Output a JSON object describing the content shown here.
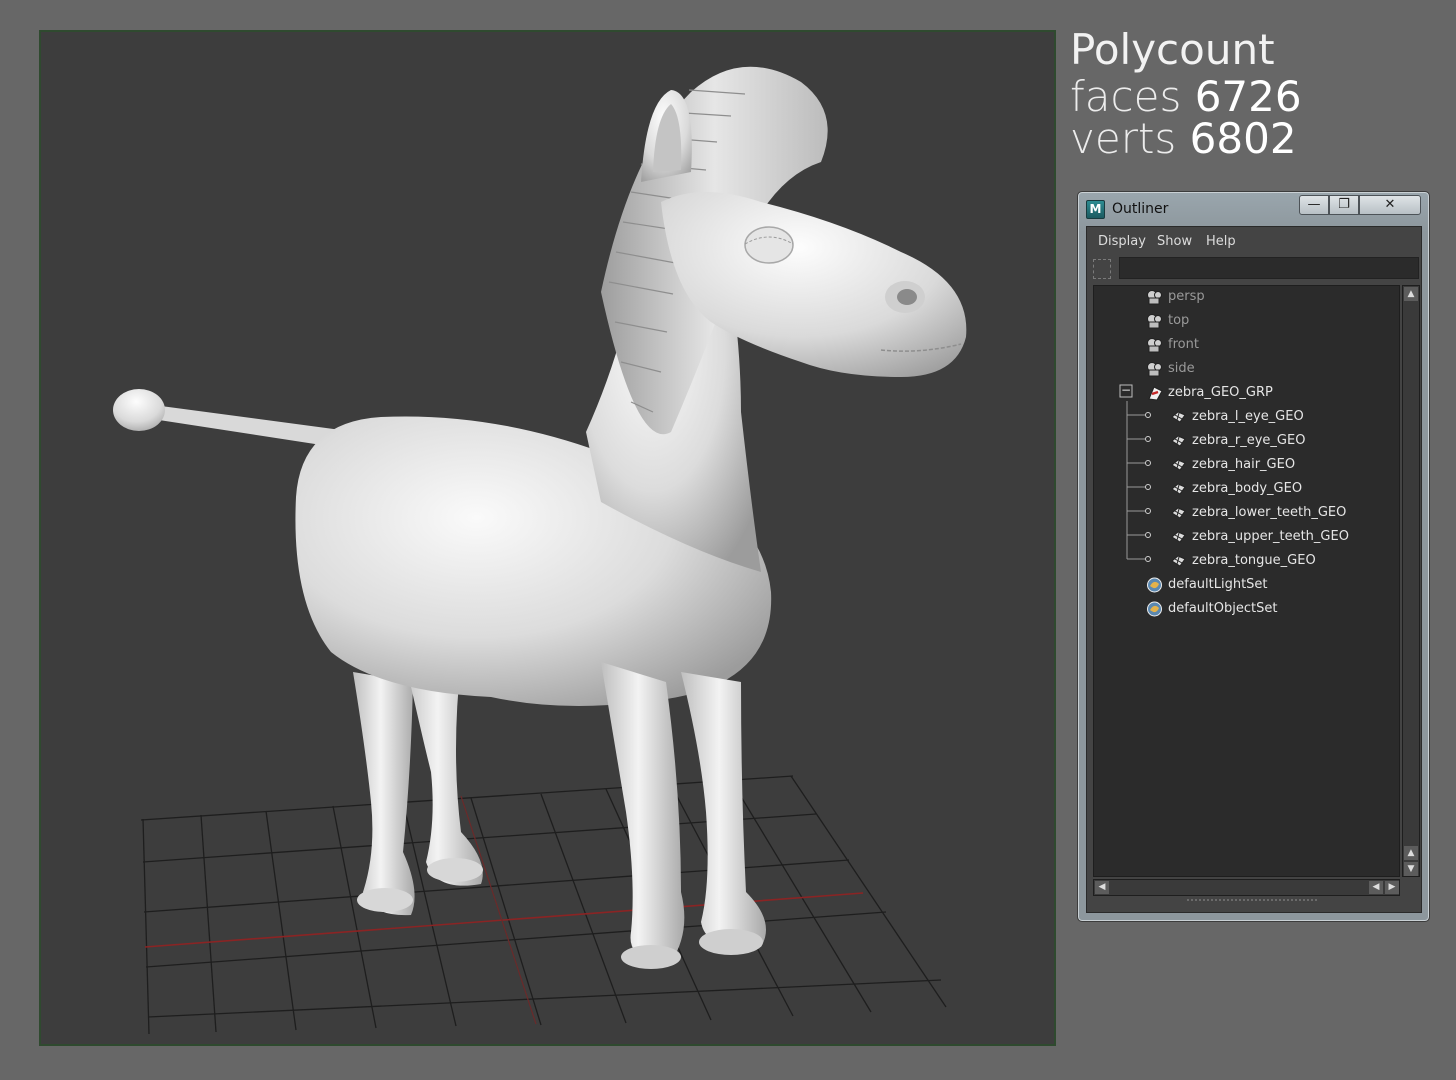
{
  "polycount": {
    "title": "Polycount",
    "faces_label": "faces",
    "faces_value": "6726",
    "verts_label": "verts",
    "verts_value": "6802"
  },
  "outliner": {
    "title": "Outliner",
    "app_icon_glyph": "M",
    "min_glyph": "—",
    "max_glyph": "❐",
    "close_glyph": "✕",
    "menu": [
      "Display",
      "Show",
      "Help"
    ],
    "search_value": "",
    "expand_glyph": "−",
    "nodes": [
      {
        "label": "persp",
        "icon": "camera-icon"
      },
      {
        "label": "top",
        "icon": "camera-icon"
      },
      {
        "label": "front",
        "icon": "camera-icon"
      },
      {
        "label": "side",
        "icon": "camera-icon"
      },
      {
        "label": "zebra_GEO_GRP",
        "icon": "group-icon"
      },
      {
        "label": "zebra_l_eye_GEO",
        "icon": "mesh-icon"
      },
      {
        "label": "zebra_r_eye_GEO",
        "icon": "mesh-icon"
      },
      {
        "label": "zebra_hair_GEO",
        "icon": "mesh-icon"
      },
      {
        "label": "zebra_body_GEO",
        "icon": "mesh-icon"
      },
      {
        "label": "zebra_lower_teeth_GEO",
        "icon": "mesh-icon"
      },
      {
        "label": "zebra_upper_teeth_GEO",
        "icon": "mesh-icon"
      },
      {
        "label": "zebra_tongue_GEO",
        "icon": "mesh-icon"
      },
      {
        "label": "defaultLightSet",
        "icon": "set-icon"
      },
      {
        "label": "defaultObjectSet",
        "icon": "set-icon"
      }
    ]
  },
  "colors": {
    "background": "#676767",
    "viewport": "#3d3d3d",
    "grid": "#1f1f1f",
    "grid_axis": "#8b2424",
    "model": "#e8e8e8"
  }
}
